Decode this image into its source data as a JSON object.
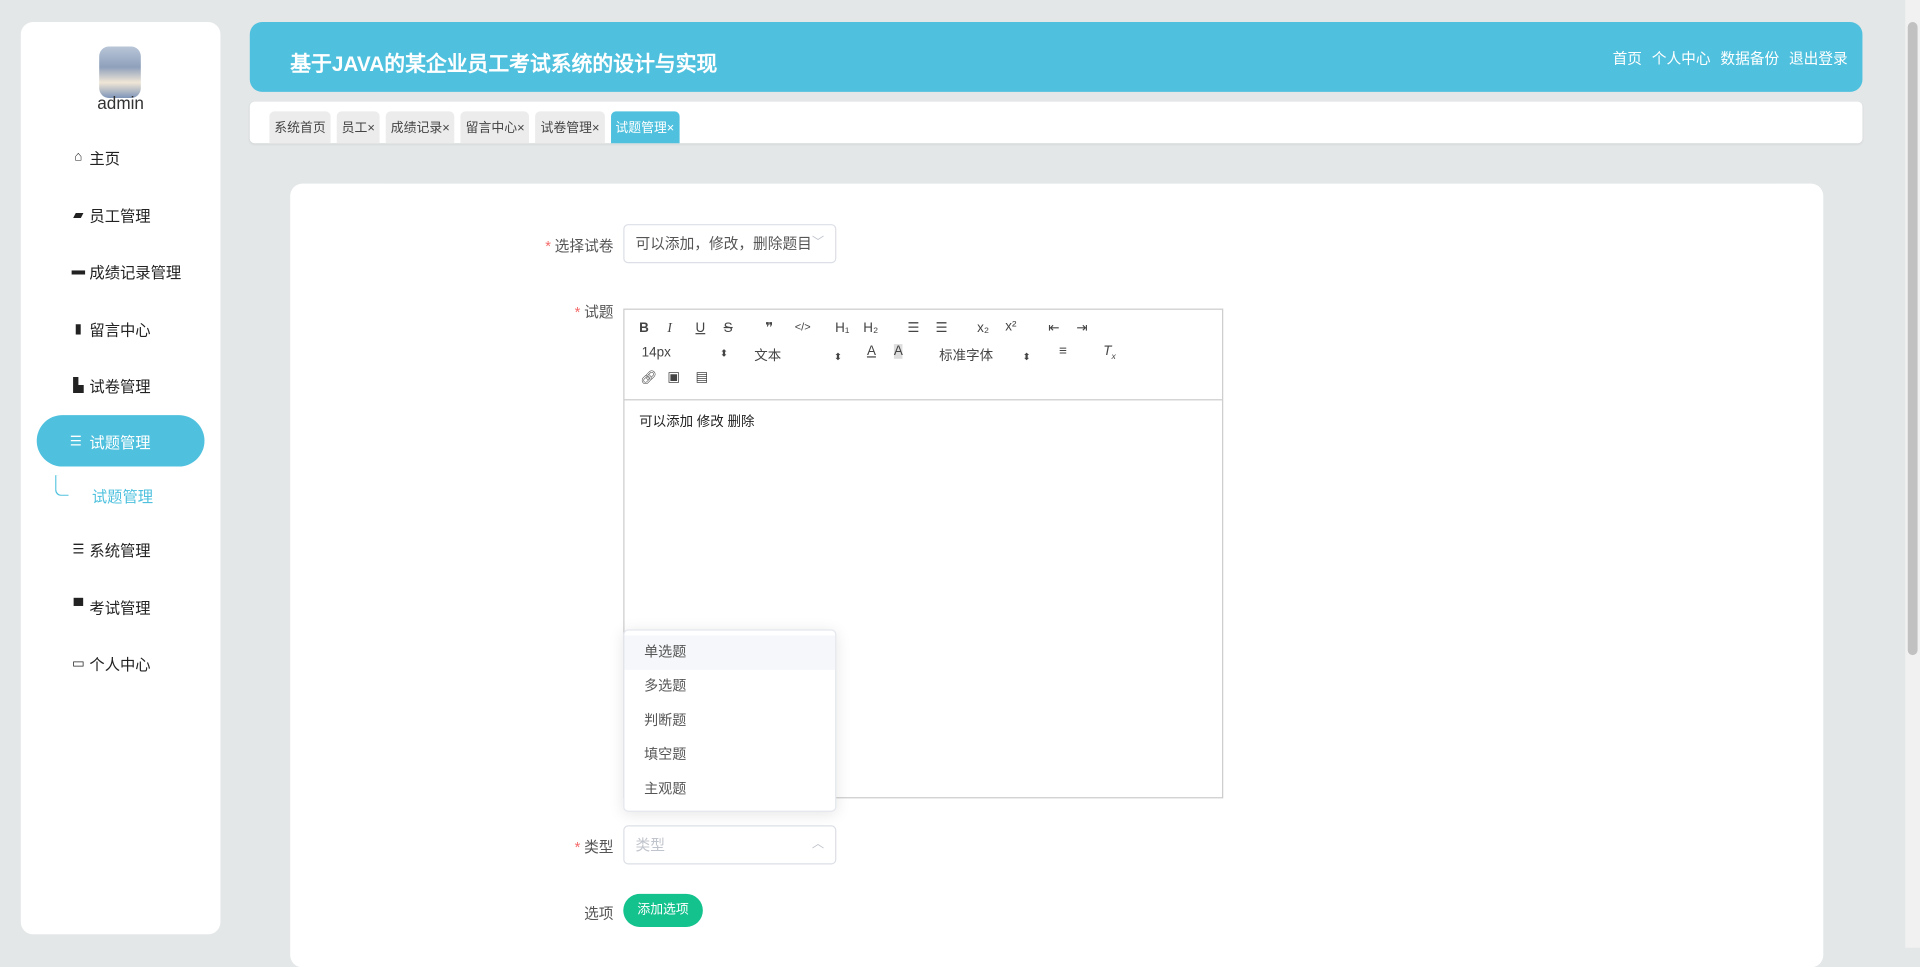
{
  "sidebar": {
    "username": "admin",
    "items": [
      {
        "label": "主页",
        "icon": "home-icon"
      },
      {
        "label": "员工管理",
        "icon": "wallet-icon"
      },
      {
        "label": "成绩记录管理",
        "icon": "monitor-icon"
      },
      {
        "label": "留言中心",
        "icon": "bar-chart-icon"
      },
      {
        "label": "试卷管理",
        "icon": "book-icon"
      },
      {
        "label": "试题管理",
        "icon": "list-icon"
      },
      {
        "label": "系统管理",
        "icon": "menu-icon"
      },
      {
        "label": "考试管理",
        "icon": "briefcase-icon"
      },
      {
        "label": "个人中心",
        "icon": "card-icon"
      }
    ],
    "submenu": "试题管理"
  },
  "header": {
    "title": "基于JAVA的某企业员工考试系统的设计与实现",
    "links": [
      "首页",
      "个人中心",
      "数据备份",
      "退出登录"
    ]
  },
  "tabs": [
    {
      "label": "系统首页",
      "close": ""
    },
    {
      "label": "员工",
      "close": "×"
    },
    {
      "label": "成绩记录",
      "close": "×"
    },
    {
      "label": "留言中心",
      "close": "×"
    },
    {
      "label": "试卷管理",
      "close": "×"
    },
    {
      "label": "试题管理",
      "close": "×"
    }
  ],
  "form": {
    "paper_label": "选择试卷",
    "paper_value": "可以添加，修改，删除题目",
    "question_label": "试题",
    "editor": {
      "font_size": "14px",
      "format": "文本",
      "font": "标准字体",
      "content": "可以添加 修改 删除"
    },
    "type_label": "类型",
    "type_placeholder": "类型",
    "type_options": [
      "单选题",
      "多选题",
      "判断题",
      "填空题",
      "主观题"
    ],
    "options_label": "选项",
    "add_option": "添加选项"
  },
  "colors": {
    "accent": "#4fc1de",
    "green": "#13c28d"
  }
}
